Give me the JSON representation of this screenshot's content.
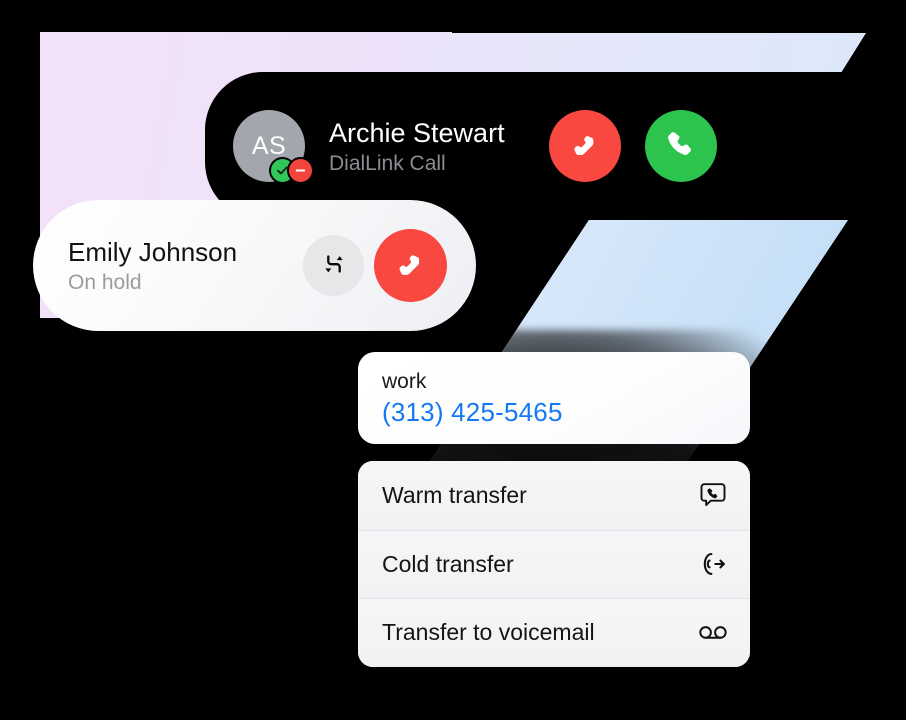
{
  "incoming_call": {
    "avatar_initials": "AS",
    "caller_name": "Archie Stewart",
    "subtitle": "DialLink Call",
    "decline_label": "Decline call",
    "accept_label": "Accept call",
    "badge_accept": "check-badge",
    "badge_decline": "minus-badge",
    "colors": {
      "card_background": "#000000",
      "avatar": "#A3A7AD",
      "decline": "#F9483F",
      "accept": "#2DC44E",
      "name_text": "#FFFFFF",
      "subtitle_text": "#8C8C92"
    }
  },
  "held_call": {
    "name": "Emily Johnson",
    "status": "On hold",
    "swap_label": "Swap calls",
    "hangup_label": "End call",
    "colors": {
      "swap_button": "#E6E7E9",
      "hangup_button": "#F9483F",
      "name_text": "#111215",
      "status_text": "#9B9BA0"
    }
  },
  "contact_number": {
    "label": "work",
    "number": "(313) 425-5465",
    "colors": {
      "label_text": "#1A1A1C",
      "number_text": "#1779F2"
    }
  },
  "transfer_menu": {
    "items": [
      {
        "label": "Warm transfer",
        "icon": "phone-in-speech-bubble-icon"
      },
      {
        "label": "Cold transfer",
        "icon": "phone-arrow-right-icon"
      },
      {
        "label": "Transfer to voicemail",
        "icon": "voicemail-icon"
      }
    ],
    "colors": {
      "background": "#F4F4F6",
      "divider": "#E2E2E6",
      "label_text": "#141416"
    }
  },
  "background": {
    "page_color": "#000000",
    "gradient_top_start": "#F5E0FA",
    "gradient_top_end": "#D9E8FA",
    "gradient_right_start": "#E2EDFB",
    "gradient_right_end": "#B9D9F4"
  }
}
